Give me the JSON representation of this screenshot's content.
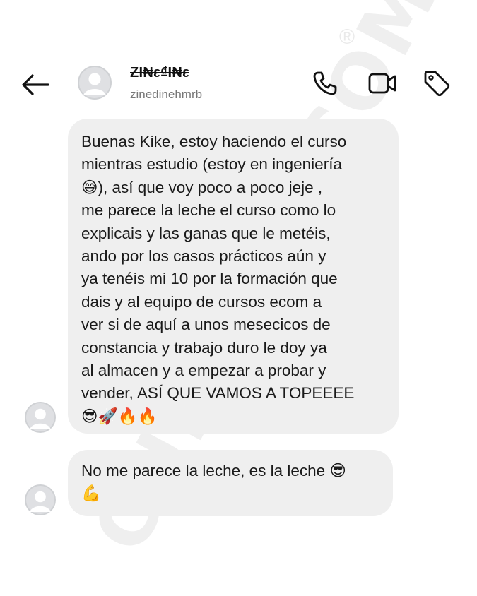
{
  "header": {
    "back_label": "Back",
    "display_name": "ZI₦ε₫I₦ε",
    "username": "zinedinehmrb",
    "icons": [
      "arrow-left-icon",
      "avatar",
      "phone-icon",
      "video-icon",
      "tag-icon"
    ]
  },
  "watermark": {
    "text": "CURSOSECOM",
    "mark": "®"
  },
  "messages": [
    {
      "sender": "contact",
      "lines": [
        "Buenas Kike, estoy haciendo el curso",
        "mientras estudio (estoy en ingeniería",
        "😅), así que voy poco a poco jeje ,",
        "me parece la leche el curso como lo",
        "explicais y las ganas que le metéis,",
        "ando por los casos prácticos aún y",
        "ya tenéis mi 10 por la formación que",
        "dais y al equipo de cursos ecom a",
        "ver si de aquí a unos mesecicos de",
        "constancia y trabajo duro le doy ya",
        "al almacen y a empezar a probar y",
        "vender, ASÍ QUE VAMOS A TOPEEEE",
        "😎🚀🔥🔥"
      ]
    },
    {
      "sender": "contact",
      "lines": [
        "No me parece la leche, es la leche 😎",
        "💪"
      ]
    }
  ]
}
